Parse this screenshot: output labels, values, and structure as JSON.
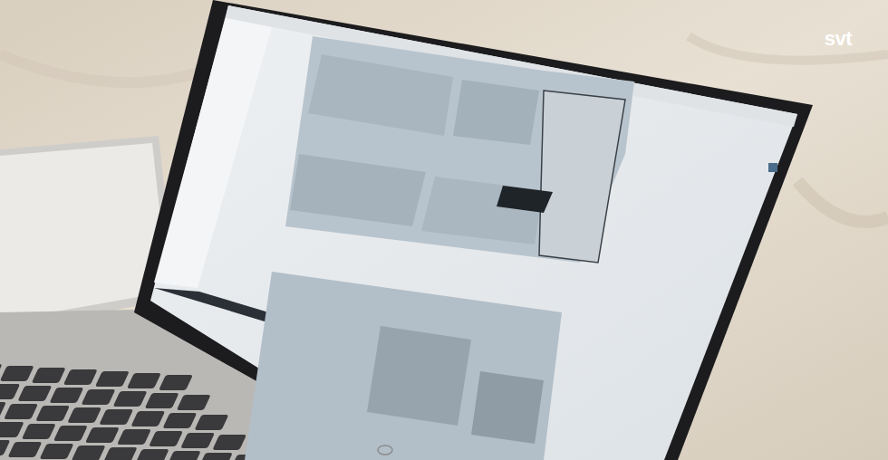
{
  "watermark": {
    "text": "svt"
  }
}
